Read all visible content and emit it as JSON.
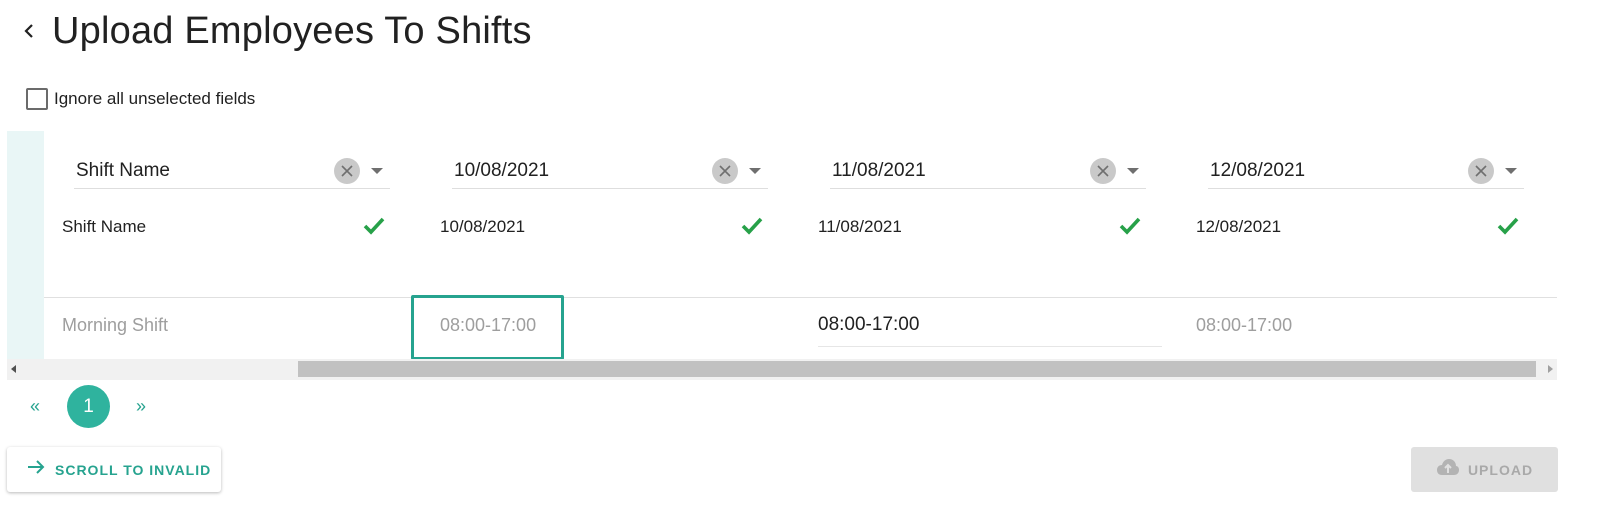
{
  "header": {
    "title": "Upload Employees To Shifts"
  },
  "options": {
    "ignore_unselected_label": "Ignore all unselected fields",
    "ignore_unselected_checked": false
  },
  "columns": [
    {
      "selected": "Shift Name",
      "matched": "Shift Name",
      "value": "Morning Shift"
    },
    {
      "selected": "10/08/2021",
      "matched": "10/08/2021",
      "value": "08:00-17:00"
    },
    {
      "selected": "11/08/2021",
      "matched": "11/08/2021",
      "value": "08:00-17:00"
    },
    {
      "selected": "12/08/2021",
      "matched": "12/08/2021",
      "value": "08:00-17:00"
    }
  ],
  "pagination": {
    "prev": "«",
    "current": "1",
    "next": "»"
  },
  "actions": {
    "scroll_to_invalid": "SCROLL TO INVALID",
    "upload": "UPLOAD"
  },
  "colors": {
    "accent": "#26a38f",
    "success": "#27a149",
    "strip": "#e9f6f6"
  }
}
